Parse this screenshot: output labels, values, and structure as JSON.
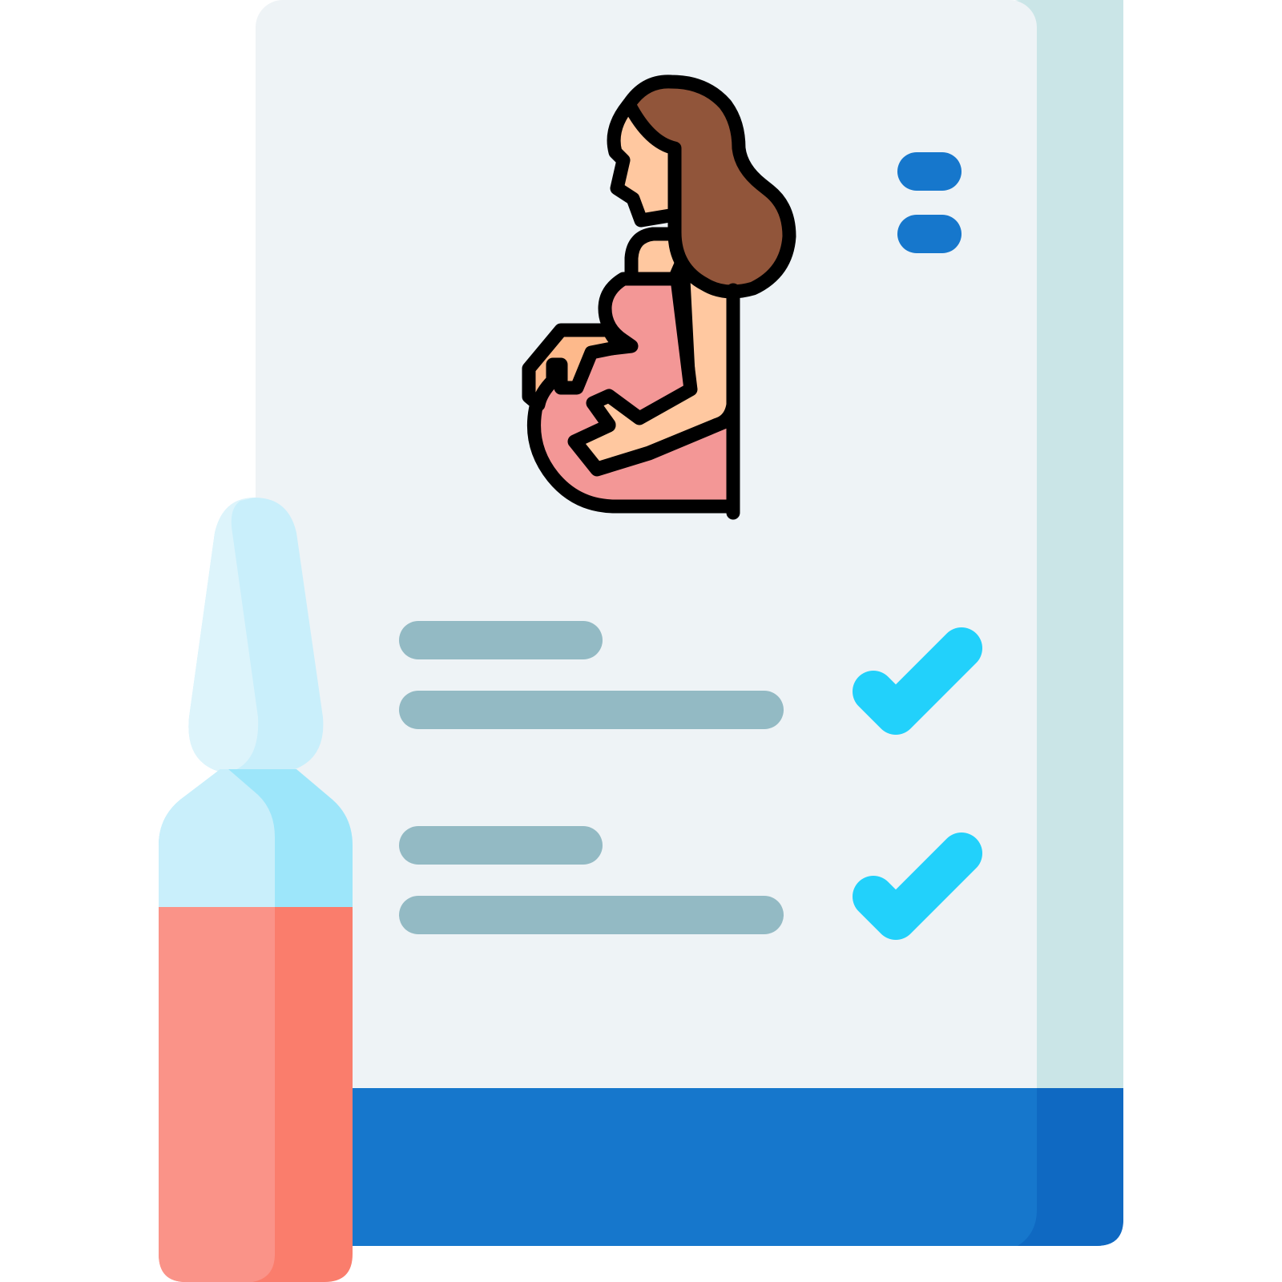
{
  "illustration": {
    "subject": "pregnant-woman",
    "checklist_items": [
      {
        "checked": true
      },
      {
        "checked": true
      }
    ]
  },
  "colors": {
    "paper": "#EEF3F6",
    "paper_shadow": "#CAE5E7",
    "footer_band": "#1677CC",
    "footer_band_shadow": "#0F69C2",
    "menu_dashes": "#1677CC",
    "text_lines": "#93BAC4",
    "check_marks": "#22D1FB",
    "ampoule_glass": "#C9EFFB",
    "ampoule_glass_highlight": "#DDF4FB",
    "ampoule_shoulder": "#9DE6FA",
    "ampoule_liquid": "#FA9388",
    "ampoule_liquid_shadow": "#FA7D6C",
    "hair": "#91553A",
    "skin": "#FFC8A0",
    "skin_hand": "#FDB98B",
    "dress": "#F39796",
    "dress_shadow": "#EE9090",
    "outline": "#000000"
  }
}
